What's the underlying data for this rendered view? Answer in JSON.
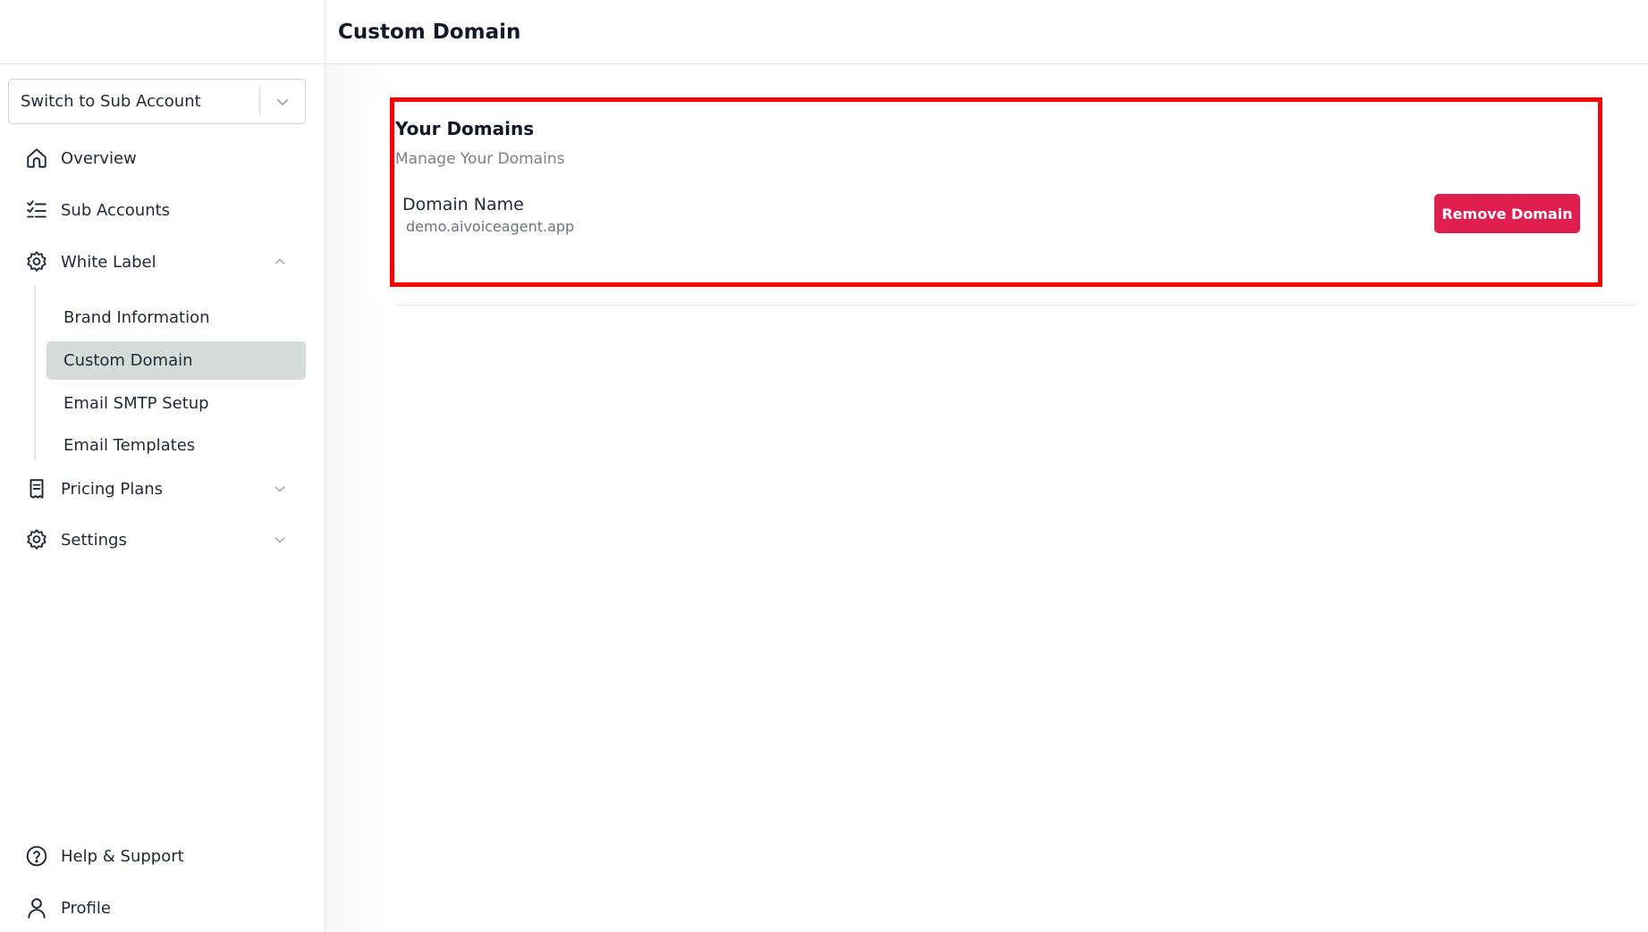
{
  "header": {
    "title": "Custom Domain"
  },
  "sidebar": {
    "account_switcher": {
      "label": "Switch to Sub Account",
      "icon": "chevron-down-icon"
    },
    "nav": [
      {
        "label": "Overview",
        "icon": "home-icon"
      },
      {
        "label": "Sub Accounts",
        "icon": "checklist-icon"
      },
      {
        "label": "White Label",
        "icon": "gear-icon",
        "expanded": true
      },
      {
        "label": "Pricing Plans",
        "icon": "receipt-icon",
        "expanded": false
      },
      {
        "label": "Settings",
        "icon": "gear-icon",
        "expanded": false
      }
    ],
    "white_label_items": [
      {
        "label": "Brand Information"
      },
      {
        "label": "Custom Domain",
        "active": true
      },
      {
        "label": "Email SMTP Setup"
      },
      {
        "label": "Email Templates"
      }
    ],
    "footer": [
      {
        "label": "Help & Support",
        "icon": "help-circle-icon"
      },
      {
        "label": "Profile",
        "icon": "user-icon"
      }
    ]
  },
  "domains_card": {
    "title": "Your Domains",
    "subtitle": "Manage Your Domains",
    "domain_label": "Domain Name",
    "domain_value": "demo.aivoiceagent.app",
    "remove_button": "Remove Domain"
  },
  "colors": {
    "accent": "#de1f4f",
    "active_bg": "#d3dcd8",
    "highlight": "#ff0000"
  }
}
